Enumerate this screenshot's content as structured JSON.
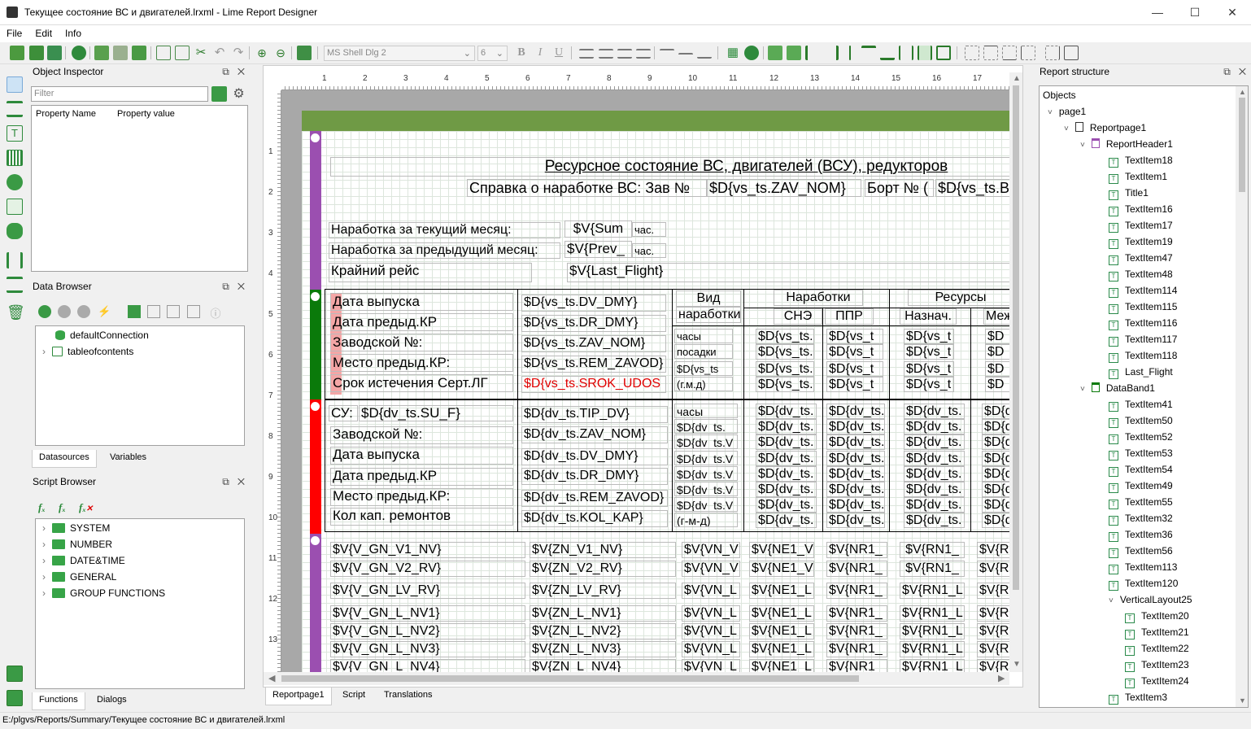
{
  "window": {
    "title": "Текущее состояние ВС и двигателей.lrxml - Lime Report Designer"
  },
  "menu": [
    "File",
    "Edit",
    "Info"
  ],
  "toolbar": {
    "font_name": "MS Shell Dlg 2",
    "font_size": "6",
    "bold": "B",
    "italic": "I",
    "underline": "U"
  },
  "object_inspector": {
    "title": "Object Inspector",
    "filter_placeholder": "Filter",
    "col_name": "Property Name",
    "col_value": "Property value"
  },
  "data_browser": {
    "title": "Data Browser",
    "items": [
      "defaultConnection",
      "tableofcontents"
    ],
    "tabs": [
      "Datasources",
      "Variables"
    ]
  },
  "script_browser": {
    "title": "Script Browser",
    "items": [
      "SYSTEM",
      "NUMBER",
      "DATE&TIME",
      "GENERAL",
      "GROUP FUNCTIONS"
    ],
    "tabs": [
      "Functions",
      "Dialogs"
    ]
  },
  "design": {
    "tabs": [
      "Reportpage1",
      "Script",
      "Translations"
    ],
    "ruler_top": [
      "1",
      "2",
      "3",
      "4",
      "5",
      "6",
      "7",
      "8",
      "9",
      "10",
      "11",
      "12",
      "13",
      "14",
      "15",
      "16",
      "17"
    ],
    "ruler_left": [
      "1",
      "2",
      "3",
      "4",
      "5",
      "6",
      "7",
      "8",
      "9",
      "10",
      "11",
      "12",
      "13"
    ],
    "header": {
      "title": "Ресурсное состояние ВС, двигателей (ВСУ), редукторов",
      "spravka": "Справка о наработке ВС: Зав №",
      "zav_nom": "$D{vs_ts.ZAV_NOM}",
      "bort": "Борт № (",
      "bort_val": "$D{vs_ts.B",
      "cur_month": "Наработка за текущий месяц:",
      "cur_val": "$V{Sum",
      "prev_month": "Наработка за предыдущий месяц:",
      "prev_val": "$V{Prev_",
      "hours": "час.",
      "last_flight": "Крайний рейс",
      "last_flight_val": "$V{Last_Flight}"
    },
    "vs_band": {
      "labels": [
        "Дата выпуска",
        "Дата предыд.КР",
        "Заводской №:",
        "Место предыд.КР:",
        "Срок истечения Серт.ЛГ"
      ],
      "values": [
        "$D{vs_ts.DV_DMY}",
        "$D{vs_ts.DR_DMY}",
        "$D{vs_ts.ZAV_NOM}",
        "$D{vs_ts.REM_ZAVOD}",
        "$D{vs_ts.SROK_UDOS"
      ],
      "vid_header": [
        "Вид",
        "наработки"
      ],
      "narabotki": "Наработки",
      "resursy": "Ресурсы",
      "sne": "СНЭ",
      "ppr": "ППР",
      "naznach": "Назнач.",
      "mezh": "Меж",
      "vid_rows": [
        "часы",
        "посадки",
        "$D{vs_ts",
        "(г.м.д)"
      ],
      "sne_val": "$D{vs_ts.",
      "ppr_val": "$D{vs_t",
      "nz_val": "$D{vs_t",
      "mz_val": "$D"
    },
    "dv_band": {
      "su_label": "СУ:",
      "su_val": "$D{dv_ts.SU_F}",
      "labels": [
        "Заводской №:",
        "Дата выпуска",
        "Дата предыд.КР",
        "Место предыд.КР:",
        "Кол кап. ремонтов"
      ],
      "values": [
        "$D{dv_ts.TIP_DV}",
        "$D{dv_ts.ZAV_NOM}",
        "$D{dv_ts.DV_DMY}",
        "$D{dv_ts.DR_DMY}",
        "$D{dv_ts.REM_ZAVOD}",
        "$D{dv_ts.KOL_KAP}"
      ],
      "vid_rows": [
        "часы",
        "$D{dv_ts.",
        "$D{dv_ts.V",
        "$D{dv_ts.V",
        "$D{dv_ts.V",
        "$D{dv_ts.V",
        "$D{dv_ts.V",
        "(г-м-д)"
      ],
      "cell": "$D{dv_ts.",
      "cell_short": "$D{d"
    },
    "footer_rows": [
      [
        "$V{V_GN_V1_NV}",
        "$V{ZN_V1_NV}",
        "$V{VN_V",
        "$V{NE1_V",
        "$V{NR1_",
        "$V{RN1_",
        "$V{R"
      ],
      [
        "$V{V_GN_V2_RV}",
        "$V{ZN_V2_RV}",
        "$V{VN_V",
        "$V{NE1_V",
        "$V{NR1_",
        "$V{RN1_",
        "$V{R"
      ],
      [
        "$V{V_GN_LV_RV}",
        "$V{ZN_LV_RV}",
        "$V{VN_L",
        "$V{NE1_L",
        "$V{NR1_",
        "$V{RN1_L",
        "$V{R"
      ],
      [
        "$V{V_GN_L_NV1}",
        "$V{ZN_L_NV1}",
        "$V{VN_L",
        "$V{NE1_L",
        "$V{NR1_",
        "$V{RN1_L",
        "$V{R"
      ],
      [
        "$V{V_GN_L_NV2}",
        "$V{ZN_L_NV2}",
        "$V{VN_L",
        "$V{NE1_L",
        "$V{NR1_",
        "$V{RN1_L",
        "$V{R"
      ],
      [
        "$V{V_GN_L_NV3}",
        "$V{ZN_L_NV3}",
        "$V{VN_L",
        "$V{NE1_L",
        "$V{NR1_",
        "$V{RN1_L",
        "$V{R"
      ],
      [
        "$V{V_GN_L_NV4}",
        "$V{ZN_L_NV4}",
        "$V{VN_L",
        "$V{NE1_L",
        "$V{NR1",
        "$V{RN1_L",
        "$V{R"
      ]
    ]
  },
  "report_structure": {
    "title": "Report structure",
    "root": "Objects",
    "nodes": [
      {
        "label": "page1",
        "level": 0
      },
      {
        "label": "Reportpage1",
        "level": 1
      },
      {
        "label": "ReportHeader1",
        "level": 2
      },
      {
        "label": "TextItem18",
        "level": 3
      },
      {
        "label": "TextItem1",
        "level": 3
      },
      {
        "label": "Title1",
        "level": 3
      },
      {
        "label": "TextItem16",
        "level": 3
      },
      {
        "label": "TextItem17",
        "level": 3
      },
      {
        "label": "TextItem19",
        "level": 3
      },
      {
        "label": "TextItem47",
        "level": 3
      },
      {
        "label": "TextItem48",
        "level": 3
      },
      {
        "label": "TextItem114",
        "level": 3
      },
      {
        "label": "TextItem115",
        "level": 3
      },
      {
        "label": "TextItem116",
        "level": 3
      },
      {
        "label": "TextItem117",
        "level": 3
      },
      {
        "label": "TextItem118",
        "level": 3
      },
      {
        "label": "Last_Flight",
        "level": 3
      },
      {
        "label": "DataBand1",
        "level": 2
      },
      {
        "label": "TextItem41",
        "level": 3
      },
      {
        "label": "TextItem50",
        "level": 3
      },
      {
        "label": "TextItem52",
        "level": 3
      },
      {
        "label": "TextItem53",
        "level": 3
      },
      {
        "label": "TextItem54",
        "level": 3
      },
      {
        "label": "TextItem49",
        "level": 3
      },
      {
        "label": "TextItem55",
        "level": 3
      },
      {
        "label": "TextItem32",
        "level": 3
      },
      {
        "label": "TextItem36",
        "level": 3
      },
      {
        "label": "TextItem56",
        "level": 3
      },
      {
        "label": "TextItem113",
        "level": 3
      },
      {
        "label": "TextItem120",
        "level": 3
      },
      {
        "label": "VerticalLayout25",
        "level": 3
      },
      {
        "label": "TextItem20",
        "level": 4
      },
      {
        "label": "TextItem21",
        "level": 4
      },
      {
        "label": "TextItem22",
        "level": 4
      },
      {
        "label": "TextItem23",
        "level": 4
      },
      {
        "label": "TextItem24",
        "level": 4
      },
      {
        "label": "TextItem3",
        "level": 3
      }
    ]
  },
  "status": "E:/plgvs/Reports/Summary/Текущее состояние ВС и двигателей.lrxml",
  "colors": {
    "band_purple": "#9b4fb0",
    "band_green": "#0a7a0a",
    "band_red": "#ff0000",
    "page_header_green": "#6f9a45",
    "accent_text_red": "#e00000"
  }
}
